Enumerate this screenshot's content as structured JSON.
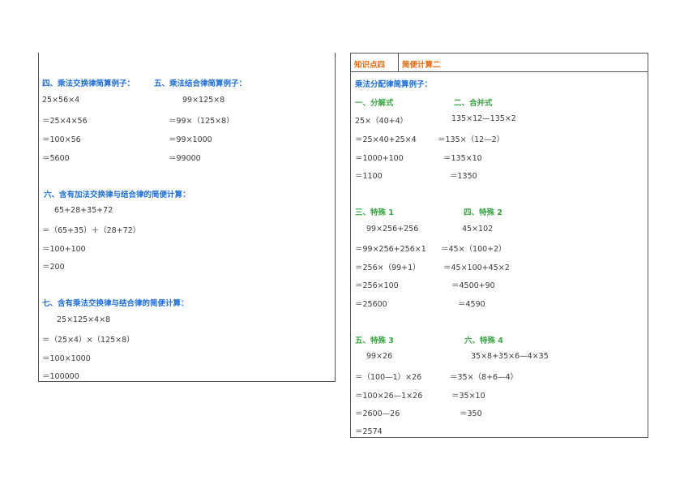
{
  "left": {
    "sec4": {
      "title": "四、乘法交换律简算例子：",
      "lines": [
        "25×56×4",
        "＝25×4×56",
        "＝100×56",
        "＝5600"
      ]
    },
    "sec5": {
      "title": "五、乘法结合律简算例子：",
      "lines": [
        "99×125×8",
        "＝99×（125×8）",
        "＝99×1000",
        "＝99000"
      ]
    },
    "sec6": {
      "title": "六、含有加法交换律与结合律的简便计算：",
      "lines": [
        "65+28+35+72",
        "＝（65+35）＋（28+72）",
        "＝100+100",
        "＝200"
      ]
    },
    "sec7": {
      "title": "七、含有乘法交换律与结合律的简便计算：",
      "lines": [
        "25×125×4×8",
        "＝（25×4）×（125×8）",
        "＝100×1000",
        "＝100000"
      ]
    }
  },
  "right": {
    "header": {
      "label": "知识点四",
      "title": "简便计算二"
    },
    "subtitle": "乘法分配律简算例子：",
    "s1": {
      "title": "一、分解式",
      "lines": [
        "25×（40+4）",
        "＝25×40+25×4",
        "＝1000+100",
        "＝1100"
      ]
    },
    "s2": {
      "title": "二、合并式",
      "lines": [
        "135×12—135×2",
        "＝135×（12—2）",
        "＝135×10",
        "＝1350"
      ]
    },
    "s3": {
      "title": "三、特殊 1",
      "lines": [
        "99×256+256",
        "＝99×256+256×1",
        "＝256×（99+1）",
        "＝256×100",
        "＝25600"
      ]
    },
    "s4": {
      "title": "四、特殊 2",
      "lines": [
        "45×102",
        "＝45×（100+2）",
        "＝45×100+45×2",
        "＝4500+90",
        "＝4590"
      ]
    },
    "s5": {
      "title": "五、特殊 3",
      "lines": [
        "99×26",
        "＝（100—1）×26",
        "＝100×26—1×26",
        "＝2600—26",
        "＝2574"
      ]
    },
    "s6": {
      "title": "六、特殊 4",
      "lines": [
        "35×8+35×6—4×35",
        "＝35×（8+6—4）",
        "＝35×10",
        "＝350"
      ]
    }
  }
}
